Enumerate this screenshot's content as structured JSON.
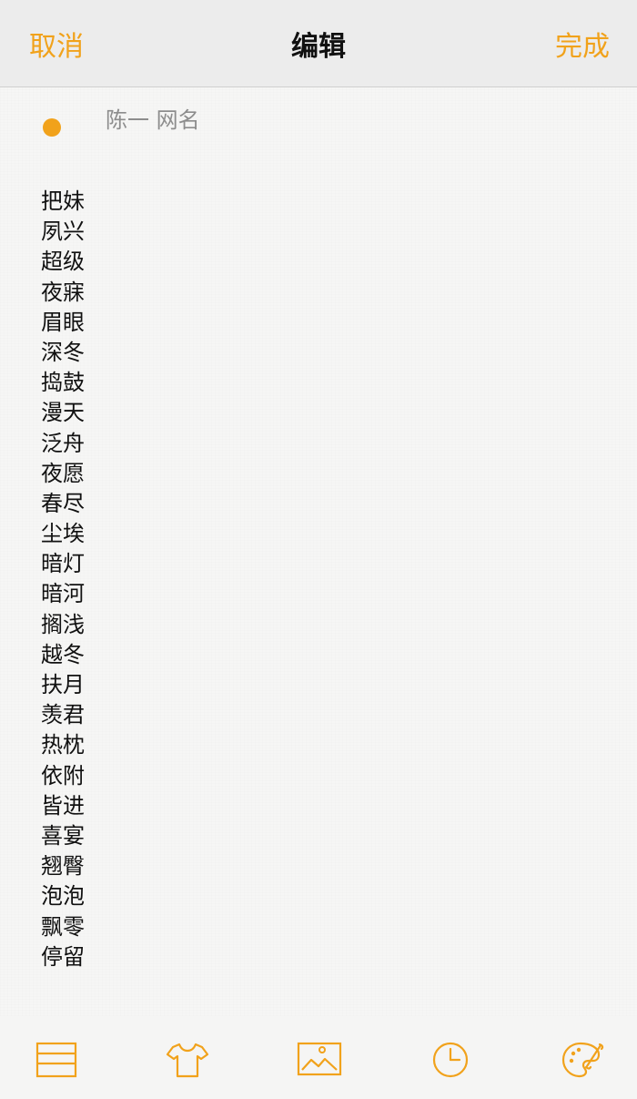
{
  "header": {
    "cancel_label": "取消",
    "title": "编辑",
    "done_label": "完成"
  },
  "note": {
    "meta": "陈一 网名",
    "lines": [
      "把妹",
      "夙兴",
      "超级",
      "夜寐",
      "眉眼",
      "深冬",
      "捣鼓",
      "漫天",
      "泛舟",
      "夜愿",
      "春尽",
      "尘埃",
      "暗灯",
      "暗河",
      "搁浅",
      "越冬",
      "扶月",
      "羡君",
      "热枕",
      "依附",
      "皆进",
      "喜宴",
      "翘臀",
      "泡泡",
      "飘零",
      "停留"
    ]
  },
  "toolbar": {
    "icons": [
      "list-icon",
      "shirt-icon",
      "image-icon",
      "clock-icon",
      "palette-icon"
    ]
  },
  "colors": {
    "accent": "#f1a21b",
    "text": "#111111",
    "meta": "#8d8d8d"
  }
}
